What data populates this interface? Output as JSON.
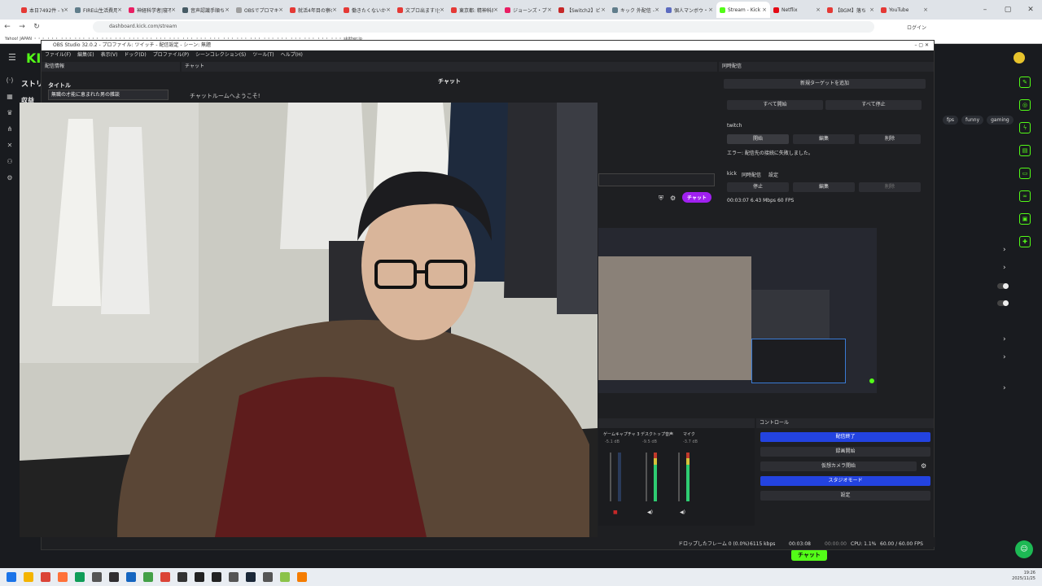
{
  "browser": {
    "tabs": [
      {
        "label": "本日7492件 - Yo",
        "color": "#e53935"
      },
      {
        "label": "FIRE山生活費用",
        "color": "#607d8b"
      },
      {
        "label": "神経科学者|寝不",
        "color": "#e91e63"
      },
      {
        "label": "音声認識手順ち",
        "color": "#455a64"
      },
      {
        "label": "OBSでプロマキーボ",
        "color": "#9e9e9e"
      },
      {
        "label": "就活4年目の寮の",
        "color": "#e53935"
      },
      {
        "label": "働きたくないから去",
        "color": "#e53935"
      },
      {
        "label": "文プロ出ます!|全",
        "color": "#e53935"
      },
      {
        "label": "東京都: 精神科病",
        "color": "#e53935"
      },
      {
        "label": "ジョーンズ・プレンロ",
        "color": "#e91e63"
      },
      {
        "label": "【Switch2】ビックカ",
        "color": "#c62828"
      },
      {
        "label": "キック 外配信 -",
        "color": "#607d8b"
      },
      {
        "label": "個人マンボウ・ -",
        "color": "#5c6bc0"
      },
      {
        "label": "Stream - Kick",
        "color": "#53fc18",
        "active": true
      },
      {
        "label": "Netflix",
        "color": "#e50914"
      },
      {
        "label": "【BGM】落ち",
        "color": "#e53935"
      },
      {
        "label": "YouTube",
        "color": "#e53935"
      }
    ],
    "url": "dashboard.kick.com/stream",
    "login_label": "ログイン",
    "bookmarks": "Yahoo! JAPAN ・・・ ・・・ ・・・ ・・・ ・・・ ・・・ ・・・ ・・・ ・・・ ・・・ ・・・ ・・・ ・・・ ・・・ ・・・ ・・・ ・・・ ・・・ ・・・ ・・・ ・・・ ・・・ ・・・ skither.io"
  },
  "kick": {
    "logo": "KICK",
    "stream_label": "ストリ",
    "revenue_label": "収益",
    "tags": [
      "fps",
      "funny",
      "gaming"
    ],
    "bottom_chat": "チャット"
  },
  "obs": {
    "title": "OBS Studio 32.0.2 - プロファイル: ツイッチ - 配信設定 - シーン: 無題",
    "menu": [
      "ファイル(F)",
      "編集(E)",
      "表示(V)",
      "ドック(D)",
      "プロファイル(P)",
      "シーンコレクション(S)",
      "ツール(T)",
      "ヘルプ(H)"
    ],
    "stream_info": {
      "header": "配信情報",
      "title_label": "タイトル",
      "title_value": "無職の才能に恵まれた男の雑談"
    },
    "chat": {
      "header": "チャット",
      "title": "チャット",
      "welcome": "チャットルームへようこそ!",
      "send": "チャット"
    },
    "multistream": {
      "header": "同時配信",
      "add_target": "新規ターゲットを追加",
      "start_all": "すべて開始",
      "stop_all": "すべて停止",
      "twitch": {
        "name": "twitch",
        "start": "開始",
        "edit": "編集",
        "delete": "削除",
        "error": "エラー: 配信先の接続に失敗しました。"
      },
      "kick": {
        "name": "kick",
        "sub1": "同時配信",
        "sub2": "設定",
        "stop": "停止",
        "edit": "編集",
        "delete": "削除",
        "stats": "00:03:07  6.43 Mbps  60 FPS"
      }
    },
    "mixer": {
      "channels": [
        {
          "name": "ゲームキャプチャ 3",
          "db": "-5.1 dB"
        },
        {
          "name": "デスクトップ音声",
          "db": "-9.5 dB"
        },
        {
          "name": "マイク",
          "db": "-3.7 dB"
        }
      ]
    },
    "controls": {
      "header": "コントロール",
      "stop_stream": "配信終了",
      "start_record": "録画開始",
      "virtual_cam": "仮想カメラ開始",
      "studio_mode": "スタジオモード",
      "settings": "設定"
    },
    "status": {
      "dropped": "ドロップしたフレーム 0 (0.0%)",
      "bitrate": "6115 kbps",
      "live_time": "00:03:08",
      "rec_time": "00:00:00",
      "cpu": "CPU: 1.1%",
      "fps": "60.00 / 60.00 FPS"
    }
  },
  "taskbar": {
    "icons": [
      {
        "name": "windows-start-icon",
        "color": "#1a73e8"
      },
      {
        "name": "file-explorer-icon",
        "color": "#f4b400"
      },
      {
        "name": "chrome-icon",
        "color": "#db4437"
      },
      {
        "name": "firefox-icon",
        "color": "#ff7139"
      },
      {
        "name": "edge-icon",
        "color": "#0f9d58"
      },
      {
        "name": "app-icon-1",
        "color": "#555555"
      },
      {
        "name": "obs-icon",
        "color": "#302e31"
      },
      {
        "name": "clip-studio-icon",
        "color": "#1565c0"
      },
      {
        "name": "app-icon-2",
        "color": "#43a047"
      },
      {
        "name": "chrome-alt-icon",
        "color": "#db4437"
      },
      {
        "name": "terminal-icon",
        "color": "#333333"
      },
      {
        "name": "app-icon-3",
        "color": "#222222"
      },
      {
        "name": "app-icon-4",
        "color": "#222222"
      },
      {
        "name": "app-icon-5",
        "color": "#555555"
      },
      {
        "name": "steam-icon",
        "color": "#1b2838"
      },
      {
        "name": "app-icon-6",
        "color": "#555555"
      },
      {
        "name": "app-icon-7",
        "color": "#8bc34a"
      },
      {
        "name": "app-icon-8",
        "color": "#f57c00"
      }
    ],
    "time": "19:26",
    "date": "2025/11/25"
  }
}
